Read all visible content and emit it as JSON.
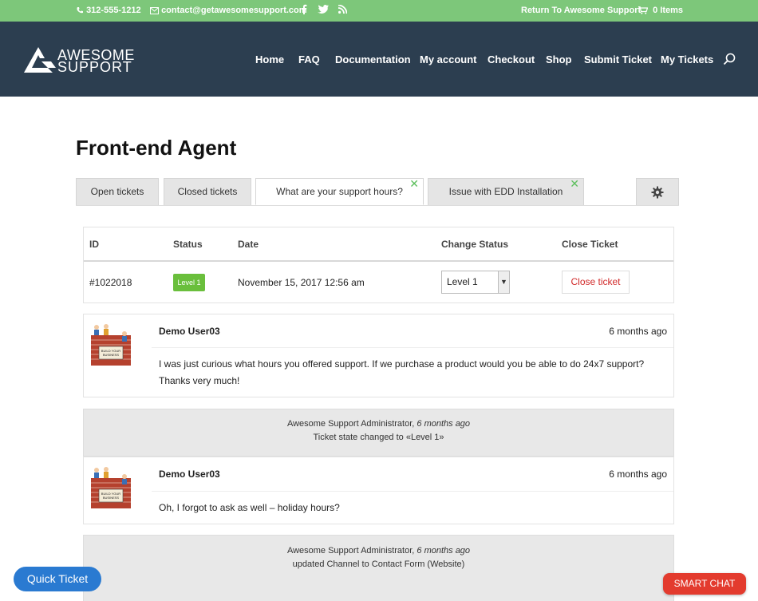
{
  "topbar": {
    "phone": "312-555-1212",
    "email": "contact@getawesomesupport.com",
    "return_link": "Return To Awesome Support",
    "cart": "0 Items"
  },
  "header": {
    "logo_line1": "AWESOME",
    "logo_line2": "SUPPORT",
    "nav": [
      "Home",
      "FAQ",
      "Documentation",
      "My account",
      "Checkout",
      "Shop",
      "Submit Ticket",
      "My Tickets"
    ]
  },
  "page": {
    "title": "Front-end Agent"
  },
  "tabs": [
    {
      "label": "Open tickets"
    },
    {
      "label": "Closed tickets"
    },
    {
      "label": "What are your support hours?"
    },
    {
      "label": "Issue with EDD Installation"
    }
  ],
  "ticket": {
    "headers": [
      "ID",
      "Status",
      "Date",
      "Change Status",
      "Close Ticket"
    ],
    "id": "#1022018",
    "status": "Level 1",
    "date": "November 15, 2017 12:56 am",
    "change_status_value": "Level 1",
    "close_label": "Close ticket"
  },
  "thread": {
    "msg1": {
      "author": "Demo User03",
      "time": "6 months ago",
      "body": "I was just curious what hours you offered support.  If we purchase a product would you be able to do 24x7 support? Thanks very much!"
    },
    "event1": {
      "actor": "Awesome Support Administrator,",
      "when": "6 months ago",
      "text": "Ticket state changed to «Level 1»"
    },
    "msg2": {
      "author": "Demo User03",
      "time": "6 months ago",
      "body": "Oh, I forgot to ask as well – holiday hours?"
    },
    "event2": {
      "actor": "Awesome Support Administrator,",
      "when": "6 months ago",
      "text": "updated Channel to Contact Form (Website)"
    }
  },
  "floating": {
    "quick_ticket": "Quick Ticket",
    "smart_chat": "SMART CHAT"
  },
  "colors": {
    "topbar": "#7dc77a",
    "header": "#2c3e50",
    "badge": "#6abf3c",
    "close": "#d12a2a",
    "quick": "#2a7ad1",
    "smartchat": "#e33b2e"
  }
}
